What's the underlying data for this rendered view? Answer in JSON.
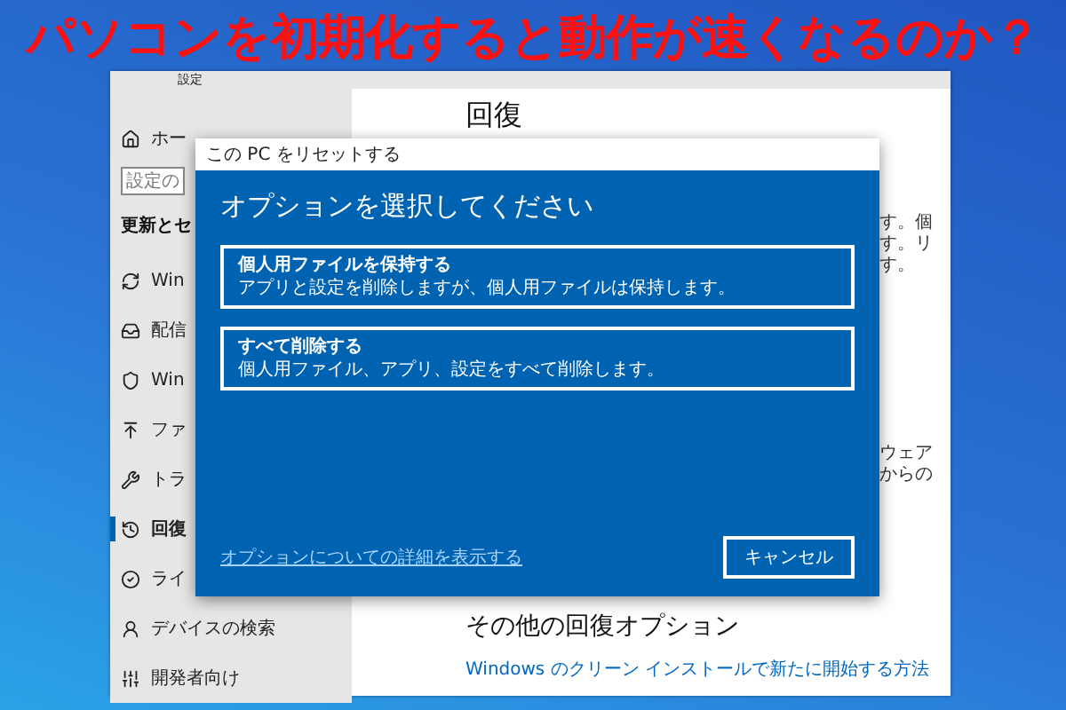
{
  "headline": "パソコンを初期化すると動作が速くなるのか？",
  "settings_window": {
    "title": "設定",
    "sidebar": {
      "home": "ホー",
      "search": {
        "placeholder": "設定の"
      },
      "section": "更新とセ",
      "items": [
        {
          "kind": "sync",
          "label": "Win",
          "selected": false
        },
        {
          "kind": "delivery",
          "label": "配信",
          "selected": false
        },
        {
          "kind": "shield",
          "label": "Win",
          "selected": false
        },
        {
          "kind": "backup",
          "label": "ファ",
          "selected": false
        },
        {
          "kind": "wrench",
          "label": "トラ",
          "selected": false
        },
        {
          "kind": "recovery",
          "label": "回復",
          "selected": true
        },
        {
          "kind": "activation",
          "label": "ライ",
          "selected": false
        },
        {
          "kind": "find",
          "label": "デバイスの検索",
          "selected": false
        },
        {
          "kind": "developer",
          "label": "開発者向け",
          "selected": false
        }
      ]
    },
    "content": {
      "heading": "回復",
      "fragments_top": [
        "す。個",
        "す。リ",
        "す。"
      ],
      "fragments_bottom": [
        "ウェア",
        "からの"
      ],
      "other_heading": "その他の回復オプション",
      "link": "Windows のクリーン インストールで新たに開始する方法"
    }
  },
  "dialog": {
    "title": "この PC をリセットする",
    "heading": "オプションを選択してください",
    "options": [
      {
        "title": "個人用ファイルを保持する",
        "description": "アプリと設定を削除しますが、個人用ファイルは保持します。"
      },
      {
        "title": "すべて削除する",
        "description": "個人用ファイル、アプリ、設定をすべて削除します。"
      }
    ],
    "link": "オプションについての詳細を表示する",
    "cancel": "キャンセル"
  }
}
